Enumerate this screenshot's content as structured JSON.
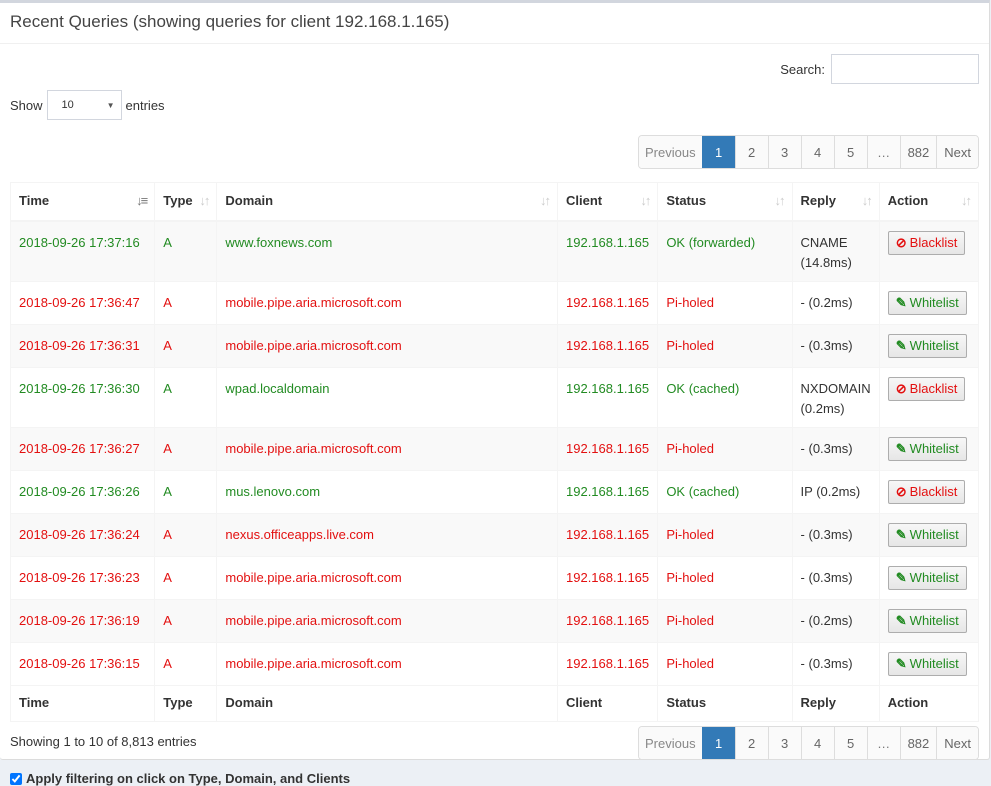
{
  "header": {
    "title": "Recent Queries (showing queries for client 192.168.1.165)"
  },
  "controls": {
    "show_label": "Show",
    "entries_label": "entries",
    "length_value": "10",
    "search_label": "Search:",
    "search_value": "",
    "search_placeholder": ""
  },
  "pagination": {
    "previous": "Previous",
    "next": "Next",
    "pages": [
      "1",
      "2",
      "3",
      "4",
      "5",
      "…",
      "882"
    ],
    "active": "1"
  },
  "table": {
    "columns": [
      "Time",
      "Type",
      "Domain",
      "Client",
      "Status",
      "Reply",
      "Action"
    ],
    "sort_icons": [
      "sort-amount-desc-icon",
      "sort-icon",
      "sort-icon",
      "sort-icon",
      "sort-icon",
      "sort-icon",
      "sort-icon"
    ],
    "rows": [
      {
        "time": "2018-09-26 17:37:16",
        "type": "A",
        "domain": "www.foxnews.com",
        "client": "192.168.1.165",
        "status": "OK (forwarded)",
        "reply": [
          "CNAME",
          "(14.8ms)"
        ],
        "action": "Blacklist",
        "state": "ok"
      },
      {
        "time": "2018-09-26 17:36:47",
        "type": "A",
        "domain": "mobile.pipe.aria.microsoft.com",
        "client": "192.168.1.165",
        "status": "Pi-holed",
        "reply": [
          "- (0.2ms)"
        ],
        "action": "Whitelist",
        "state": "blocked"
      },
      {
        "time": "2018-09-26 17:36:31",
        "type": "A",
        "domain": "mobile.pipe.aria.microsoft.com",
        "client": "192.168.1.165",
        "status": "Pi-holed",
        "reply": [
          "- (0.3ms)"
        ],
        "action": "Whitelist",
        "state": "blocked"
      },
      {
        "time": "2018-09-26 17:36:30",
        "type": "A",
        "domain": "wpad.localdomain",
        "client": "192.168.1.165",
        "status": "OK (cached)",
        "reply": [
          "NXDOMAIN",
          "(0.2ms)"
        ],
        "action": "Blacklist",
        "state": "ok"
      },
      {
        "time": "2018-09-26 17:36:27",
        "type": "A",
        "domain": "mobile.pipe.aria.microsoft.com",
        "client": "192.168.1.165",
        "status": "Pi-holed",
        "reply": [
          "- (0.3ms)"
        ],
        "action": "Whitelist",
        "state": "blocked"
      },
      {
        "time": "2018-09-26 17:36:26",
        "type": "A",
        "domain": "mus.lenovo.com",
        "client": "192.168.1.165",
        "status": "OK (cached)",
        "reply": [
          "IP (0.2ms)"
        ],
        "action": "Blacklist",
        "state": "ok"
      },
      {
        "time": "2018-09-26 17:36:24",
        "type": "A",
        "domain": "nexus.officeapps.live.com",
        "client": "192.168.1.165",
        "status": "Pi-holed",
        "reply": [
          "- (0.3ms)"
        ],
        "action": "Whitelist",
        "state": "blocked"
      },
      {
        "time": "2018-09-26 17:36:23",
        "type": "A",
        "domain": "mobile.pipe.aria.microsoft.com",
        "client": "192.168.1.165",
        "status": "Pi-holed",
        "reply": [
          "- (0.3ms)"
        ],
        "action": "Whitelist",
        "state": "blocked"
      },
      {
        "time": "2018-09-26 17:36:19",
        "type": "A",
        "domain": "mobile.pipe.aria.microsoft.com",
        "client": "192.168.1.165",
        "status": "Pi-holed",
        "reply": [
          "- (0.2ms)"
        ],
        "action": "Whitelist",
        "state": "blocked"
      },
      {
        "time": "2018-09-26 17:36:15",
        "type": "A",
        "domain": "mobile.pipe.aria.microsoft.com",
        "client": "192.168.1.165",
        "status": "Pi-holed",
        "reply": [
          "- (0.3ms)"
        ],
        "action": "Whitelist",
        "state": "blocked"
      }
    ]
  },
  "footer": {
    "info": "Showing 1 to 10 of 8,813 entries",
    "filter_label": "Apply filtering on click on Type, Domain, and Clients",
    "filter_checked": true
  },
  "colors": {
    "ok": "#228b22",
    "blocked": "#e31010",
    "active_page": "#337ab7"
  }
}
